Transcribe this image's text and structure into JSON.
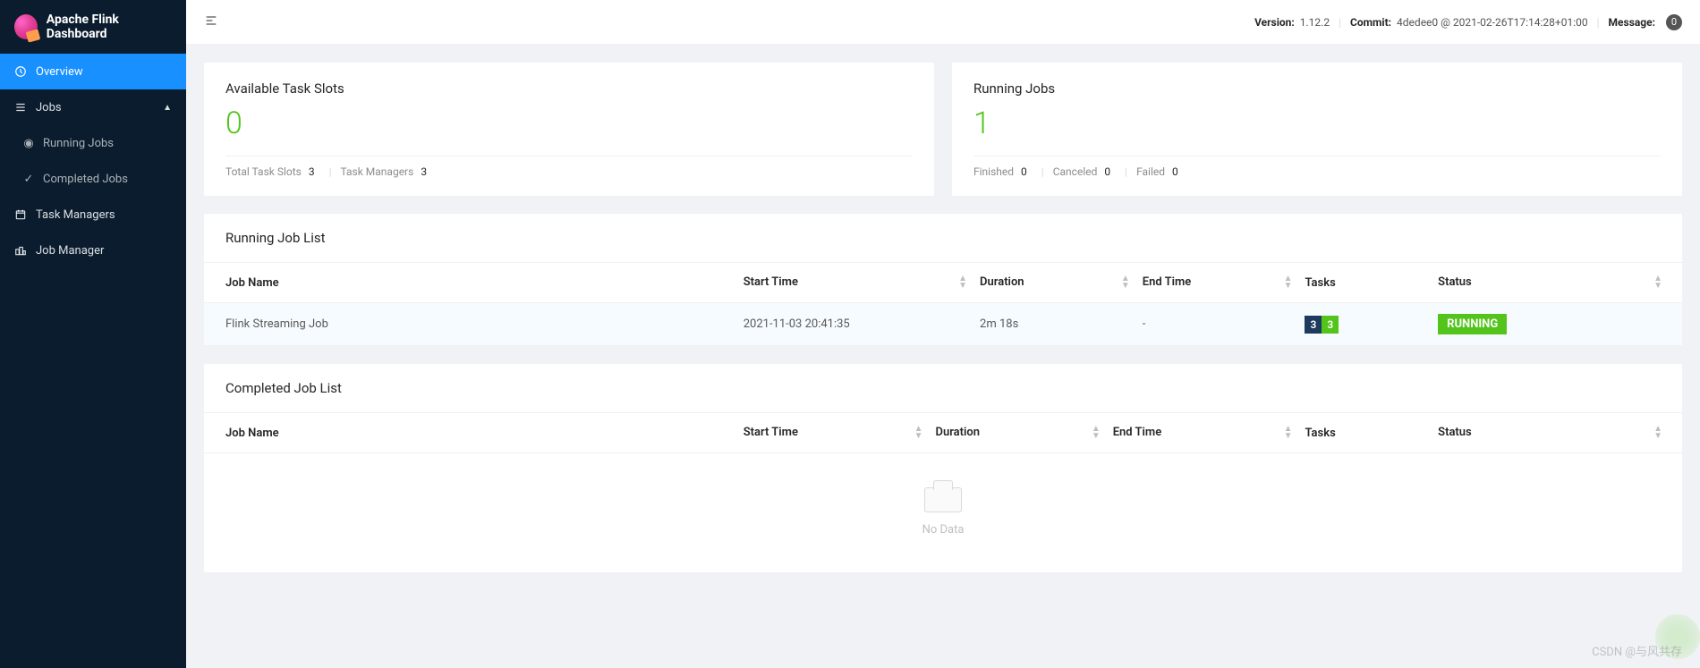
{
  "app": {
    "title": "Apache Flink Dashboard"
  },
  "topbar": {
    "version_label": "Version:",
    "version": "1.12.2",
    "commit_label": "Commit:",
    "commit": "4dedee0 @ 2021-02-26T17:14:28+01:00",
    "message_label": "Message:",
    "message_count": "0"
  },
  "nav": {
    "overview": "Overview",
    "jobs": "Jobs",
    "running_jobs": "Running Jobs",
    "completed_jobs": "Completed Jobs",
    "task_managers": "Task Managers",
    "job_manager": "Job Manager"
  },
  "slots_card": {
    "title": "Available Task Slots",
    "value": "0",
    "total_label": "Total Task Slots",
    "total_value": "3",
    "tm_label": "Task Managers",
    "tm_value": "3"
  },
  "jobs_card": {
    "title": "Running Jobs",
    "value": "1",
    "finished_label": "Finished",
    "finished_value": "0",
    "canceled_label": "Canceled",
    "canceled_value": "0",
    "failed_label": "Failed",
    "failed_value": "0"
  },
  "running_list": {
    "title": "Running Job List",
    "cols": {
      "name": "Job Name",
      "start": "Start Time",
      "duration": "Duration",
      "end": "End Time",
      "tasks": "Tasks",
      "status": "Status"
    },
    "row": {
      "name": "Flink Streaming Job",
      "start": "2021-11-03 20:41:35",
      "duration": "2m 18s",
      "end": "-",
      "tasks_a": "3",
      "tasks_b": "3",
      "status": "RUNNING"
    }
  },
  "completed_list": {
    "title": "Completed Job List",
    "cols": {
      "name": "Job Name",
      "start": "Start Time",
      "duration": "Duration",
      "end": "End Time",
      "tasks": "Tasks",
      "status": "Status"
    },
    "empty": "No Data"
  },
  "watermark": "CSDN @与风共存"
}
